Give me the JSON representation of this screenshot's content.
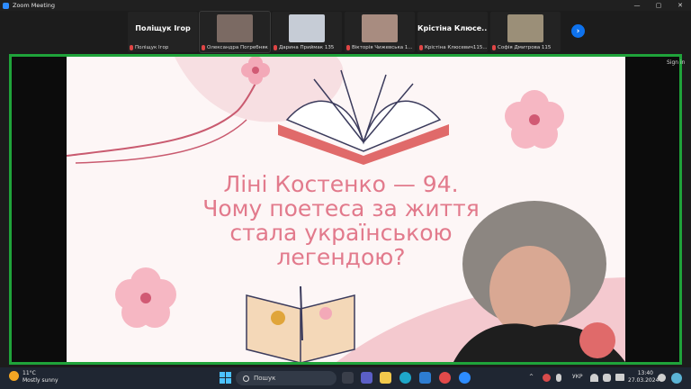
{
  "window": {
    "title": "Zoom Meeting",
    "controls": {
      "minimize": "—",
      "maximize": "▢",
      "close": "✕"
    }
  },
  "participants": [
    {
      "big_name": "Поліщук Ігор",
      "label": "Поліщук Ігор",
      "has_video": false,
      "muted": true
    },
    {
      "big_name": "",
      "label": "Олександра Погребняк",
      "has_video": true,
      "muted": true,
      "thumb_color": "#7b6a63"
    },
    {
      "big_name": "",
      "label": "Дарина Приймак 135",
      "has_video": true,
      "muted": true,
      "thumb_color": "#c6ccd6"
    },
    {
      "big_name": "",
      "label": "Вікторія Чижевська 1...",
      "has_video": true,
      "muted": true,
      "thumb_color": "#a88c80"
    },
    {
      "big_name": "Крістіна Клюсе...",
      "label": "Крістіна Клюсевич115...",
      "has_video": false,
      "muted": true
    },
    {
      "big_name": "",
      "label": "Софія Дмитрова 115",
      "has_video": true,
      "muted": true,
      "thumb_color": "#9b8f78"
    }
  ],
  "strip": {
    "next_label": "›"
  },
  "share": {
    "signin_label": "Sign in",
    "border_color": "#1fa33a",
    "slide": {
      "title_lines": [
        "Ліні Костенко — 94.",
        "Чому поетеса за життя",
        "стала українською",
        "легендою?"
      ],
      "accent_color": "#e27a8c"
    }
  },
  "taskbar": {
    "weather": {
      "temp": "11°C",
      "desc": "Mostly sunny"
    },
    "search_placeholder": "Пошук",
    "tray": {
      "chevron": "^",
      "lang": "УКР"
    },
    "clock": {
      "time": "13:40",
      "date": "27.03.2024"
    }
  }
}
